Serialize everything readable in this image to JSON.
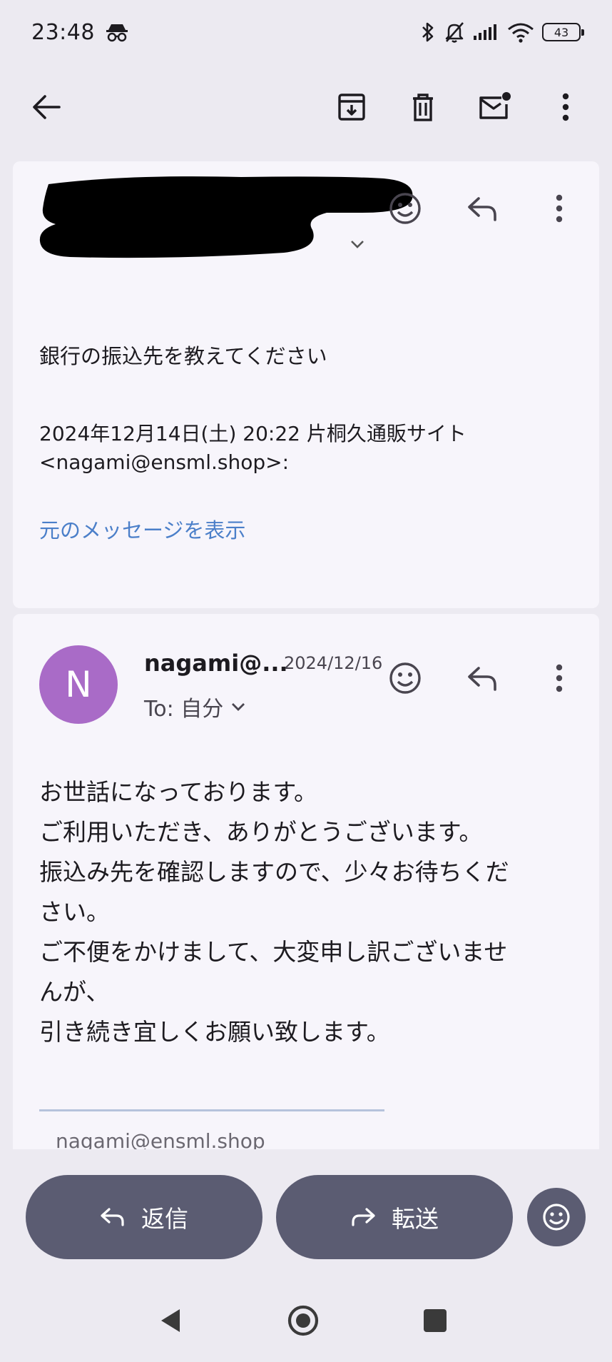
{
  "status_bar": {
    "time": "23:48",
    "battery": "43"
  },
  "top_bar": {
    "icons": [
      "back-arrow-icon",
      "archive-icon",
      "delete-icon",
      "mark-unread-icon",
      "more-vert-icon"
    ]
  },
  "message1": {
    "subject_line": "銀行の振込先を教えてください",
    "quote_header_line1": "2024年12月14日(土) 20:22 片桐久通販サイト",
    "quote_header_line2": "<nagami@ensml.shop>:",
    "show_original": "元のメッセージを表示"
  },
  "message2": {
    "avatar_letter": "N",
    "sender": "nagami@...",
    "date": "2024/12/16",
    "to_label": "To: 自分",
    "body_lines": [
      "お世話になっております。",
      "ご利用いただき、ありがとうございます。",
      "振込み先を確認しますので、少々お待ちくだ",
      "さい。",
      "ご不便をかけまして、大変申し訳ございませ",
      "んが、",
      "引き続き宜しくお願い致します。"
    ],
    "signature_peek": "nagami@ensml.shop"
  },
  "bottom_actions": {
    "reply_label": "返信",
    "forward_label": "転送"
  },
  "colors": {
    "background": "#eceaf1",
    "card": "#f7f5fb",
    "avatar": "#a96bc7",
    "link": "#4b7fc9",
    "pill": "#5b5c72"
  }
}
